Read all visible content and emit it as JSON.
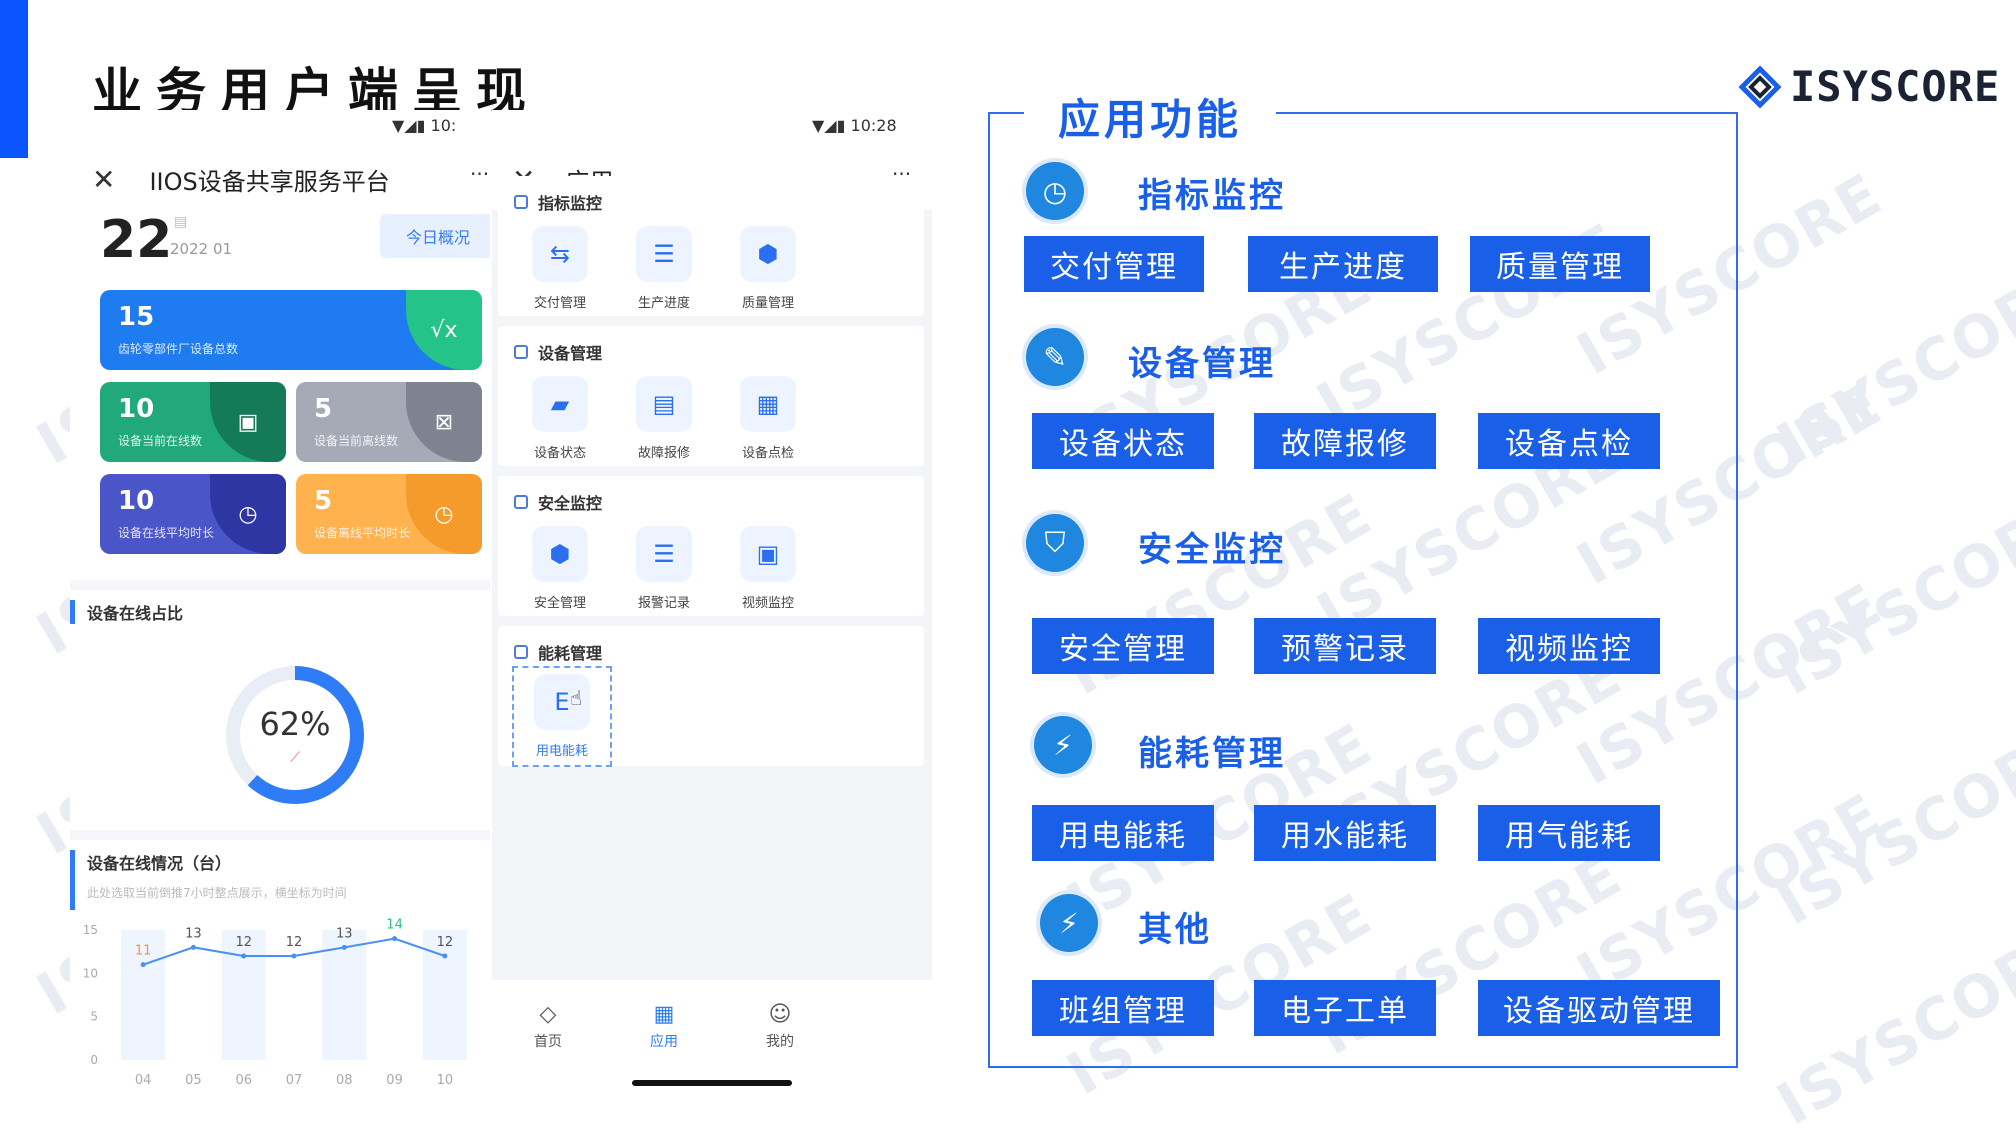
{
  "slide": {
    "title": "业务用户端呈现",
    "brand": "ISYSCORE",
    "watermark": "ISYSCORE"
  },
  "phone1": {
    "status_time": "10:",
    "header_title": "IIOS设备共享服务平台",
    "menu": "···",
    "big_number": "22",
    "date": "2022 01",
    "today_button": "今日概况",
    "stats": [
      {
        "value": "15",
        "label": "齿轮零部件厂设备总数",
        "color": "#1f7cf0",
        "corner": "#24c389",
        "icon": "√x"
      },
      {
        "value": "10",
        "label": "设备当前在线数",
        "color": "#21a97c",
        "corner": "#157a58",
        "icon": "▣"
      },
      {
        "value": "5",
        "label": "设备当前离线数",
        "color": "#a5aab6",
        "corner": "#7d8390",
        "icon": "⊠"
      },
      {
        "value": "10",
        "label": "设备在线平均时长",
        "color": "#4a55c8",
        "corner": "#2d36a3",
        "icon": "◷"
      },
      {
        "value": "5",
        "label": "设备离线平均时长",
        "color": "#ffb24e",
        "corner": "#f59b2b",
        "icon": "◷"
      }
    ],
    "online_ratio_title": "设备在线占比",
    "online_ratio_value": "62%",
    "online_ratio_fraction": 0.62,
    "online_status_title": "设备在线情况（台）",
    "online_status_subtitle": "此处选取当前倒推7小时整点展示，横坐标为时间"
  },
  "chart_data": {
    "type": "line",
    "title": "设备在线情况（台）",
    "categories": [
      "04",
      "05",
      "06",
      "07",
      "08",
      "09",
      "10"
    ],
    "series": [
      {
        "values": [
          11,
          13,
          12,
          12,
          13,
          14,
          12
        ]
      }
    ],
    "ylim": [
      0,
      15
    ],
    "yticks": [
      0,
      5,
      10,
      15
    ],
    "grid": false
  },
  "phone2": {
    "status_time": "10:28",
    "header_title": "应用",
    "menu": "···",
    "sections": [
      {
        "title": "指标监控",
        "apps": [
          "交付管理",
          "生产进度",
          "质量管理"
        ]
      },
      {
        "title": "设备管理",
        "apps": [
          "设备状态",
          "故障报修",
          "设备点检"
        ]
      },
      {
        "title": "安全监控",
        "apps": [
          "安全管理",
          "报警记录",
          "视频监控"
        ]
      },
      {
        "title": "能耗管理",
        "apps": [
          "用电能耗"
        ]
      }
    ],
    "tabs": [
      "首页",
      "应用",
      "我的"
    ]
  },
  "features": {
    "title": "应用功能",
    "categories": [
      {
        "name": "指标监控",
        "icon": "clock-icon",
        "items": [
          "交付管理",
          "生产进度",
          "质量管理"
        ]
      },
      {
        "name": "设备管理",
        "icon": "wrench-icon",
        "items": [
          "设备状态",
          "故障报修",
          "设备点检"
        ]
      },
      {
        "name": "安全监控",
        "icon": "shield-icon",
        "items": [
          "安全管理",
          "预警记录",
          "视频监控"
        ]
      },
      {
        "name": "能耗管理",
        "icon": "meter-icon",
        "items": [
          "用电能耗",
          "用水能耗",
          "用气能耗"
        ]
      },
      {
        "name": "其他",
        "icon": "meter-icon",
        "items": [
          "班组管理",
          "电子工单",
          "设备驱动管理"
        ]
      }
    ]
  },
  "colors": {
    "accent": "#1a5fe8",
    "header_bar": "#0b55ff"
  }
}
